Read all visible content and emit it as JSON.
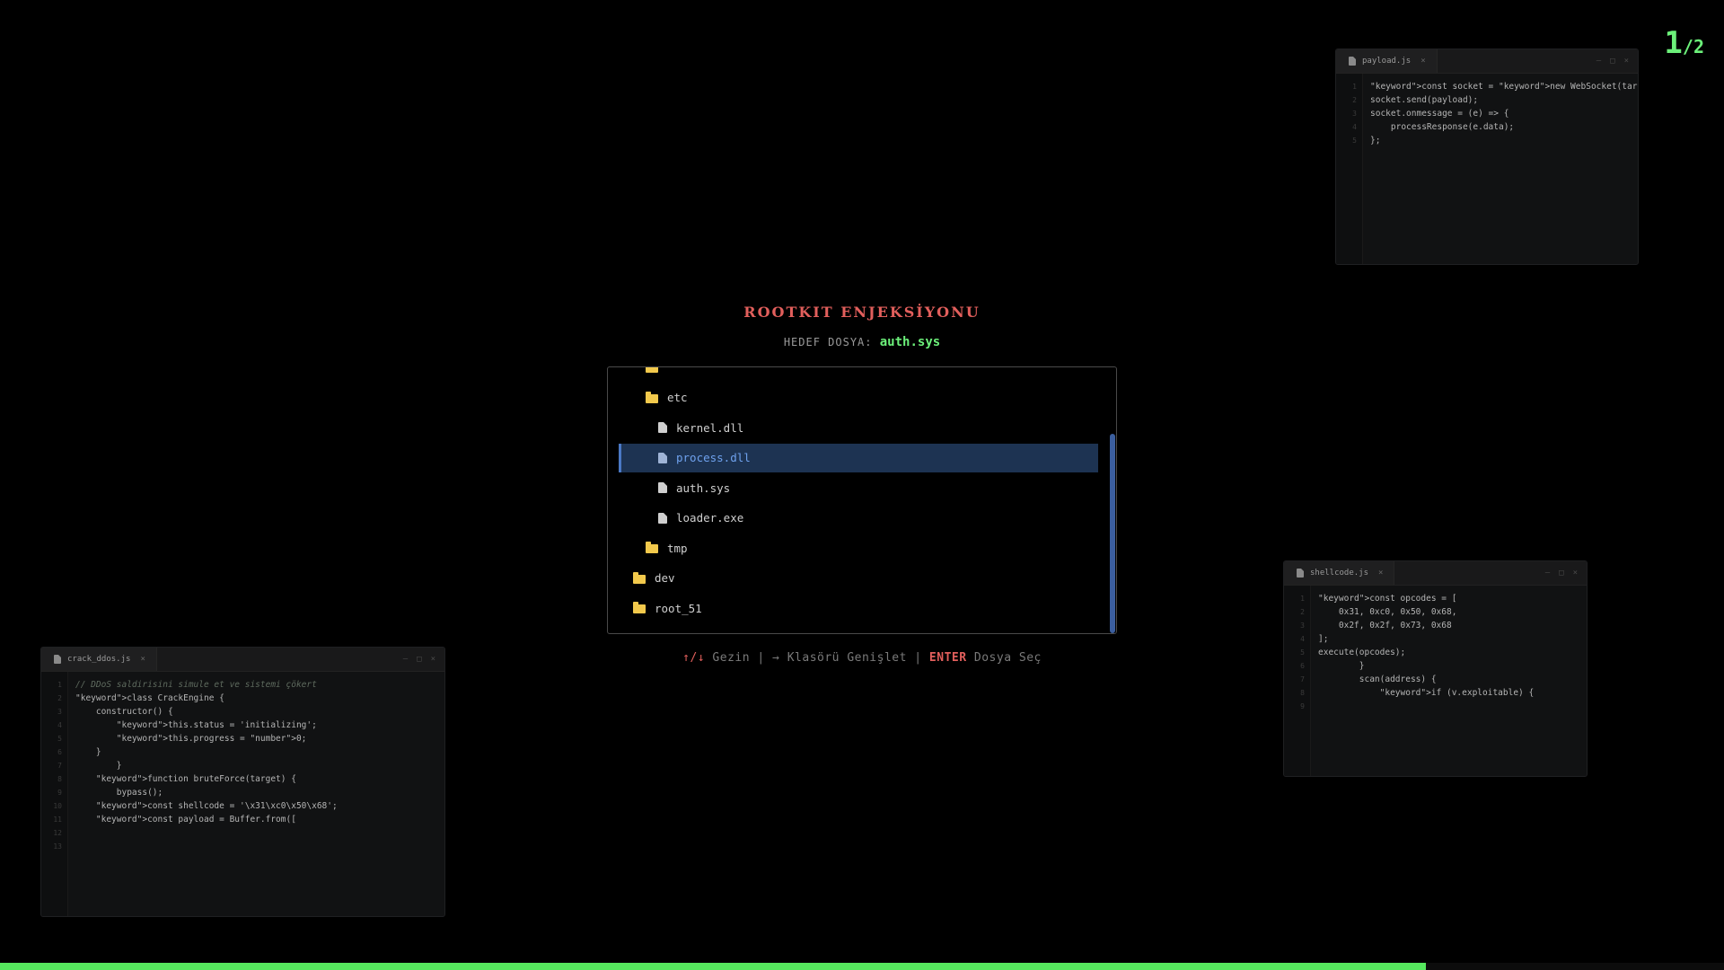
{
  "counter": {
    "current": "1",
    "total": "/2"
  },
  "title": "ROOTKIT ENJEKSİYONU",
  "target": {
    "label": "HEDEF DOSYA:",
    "file": "auth.sys"
  },
  "tree": {
    "items": [
      {
        "type": "folder",
        "label": "",
        "depth": 1
      },
      {
        "type": "folder",
        "label": "etc",
        "depth": 1
      },
      {
        "type": "file",
        "label": "kernel.dll",
        "depth": 2
      },
      {
        "type": "file",
        "label": "process.dll",
        "depth": 2,
        "selected": true
      },
      {
        "type": "file",
        "label": "auth.sys",
        "depth": 2
      },
      {
        "type": "file",
        "label": "loader.exe",
        "depth": 2
      },
      {
        "type": "folder",
        "label": "tmp",
        "depth": 1
      },
      {
        "type": "folder",
        "label": "dev",
        "depth": 0
      },
      {
        "type": "folder",
        "label": "root_51",
        "depth": 0
      }
    ]
  },
  "hint": {
    "arrows": "↑/↓",
    "navigate": " Gezin ",
    "sep1": "|",
    "expand": " → Klasörü Genişlet ",
    "sep2": "|",
    "enter": " ENTER",
    "select": " Dosya Seç"
  },
  "progress": {
    "value": 0.827
  },
  "windows": {
    "payload": {
      "tab": "payload.js",
      "lines": [
        "\"keyword\">const socket = \"keyword\">new WebSocket(target);",
        "socket.send(payload);",
        "socket.onmessage = (e) => {",
        "    processResponse(e.data);",
        "};"
      ],
      "line_numbers": [
        "1",
        "2",
        "3",
        "4",
        "5"
      ]
    },
    "shellcode": {
      "tab": "shellcode.js",
      "lines": [
        "\"keyword\">const opcodes = [",
        "    0x31, 0xc0, 0x50, 0x68,",
        "    0x2f, 0x2f, 0x73, 0x68",
        "];",
        "execute(opcodes);",
        "        }",
        "        scan(address) {",
        "            \"keyword\">if (v.exploitable) {",
        ""
      ],
      "line_numbers": [
        "1",
        "2",
        "3",
        "4",
        "5",
        "6",
        "7",
        "8",
        "9"
      ]
    },
    "crack": {
      "tab": "crack_ddos.js",
      "lines": [
        "// DDoS saldirisini simule et ve sistemi çökert",
        "\"keyword\">class CrackEngine {",
        "    constructor() {",
        "        \"keyword\">this.status = 'initializing';",
        "        \"keyword\">this.progress = \"number\">0;",
        "    }",
        "        }",
        "    \"keyword\">function bruteForce(target) {",
        "        bypass();",
        "    \"keyword\">const shellcode = '\\x31\\xc0\\x50\\x68';",
        "    \"keyword\">const payload = Buffer.from([",
        "",
        ""
      ],
      "line_numbers": [
        "1",
        "2",
        "3",
        "4",
        "5",
        "6",
        "7",
        "8",
        "9",
        "10",
        "11",
        "12",
        "13"
      ]
    }
  }
}
